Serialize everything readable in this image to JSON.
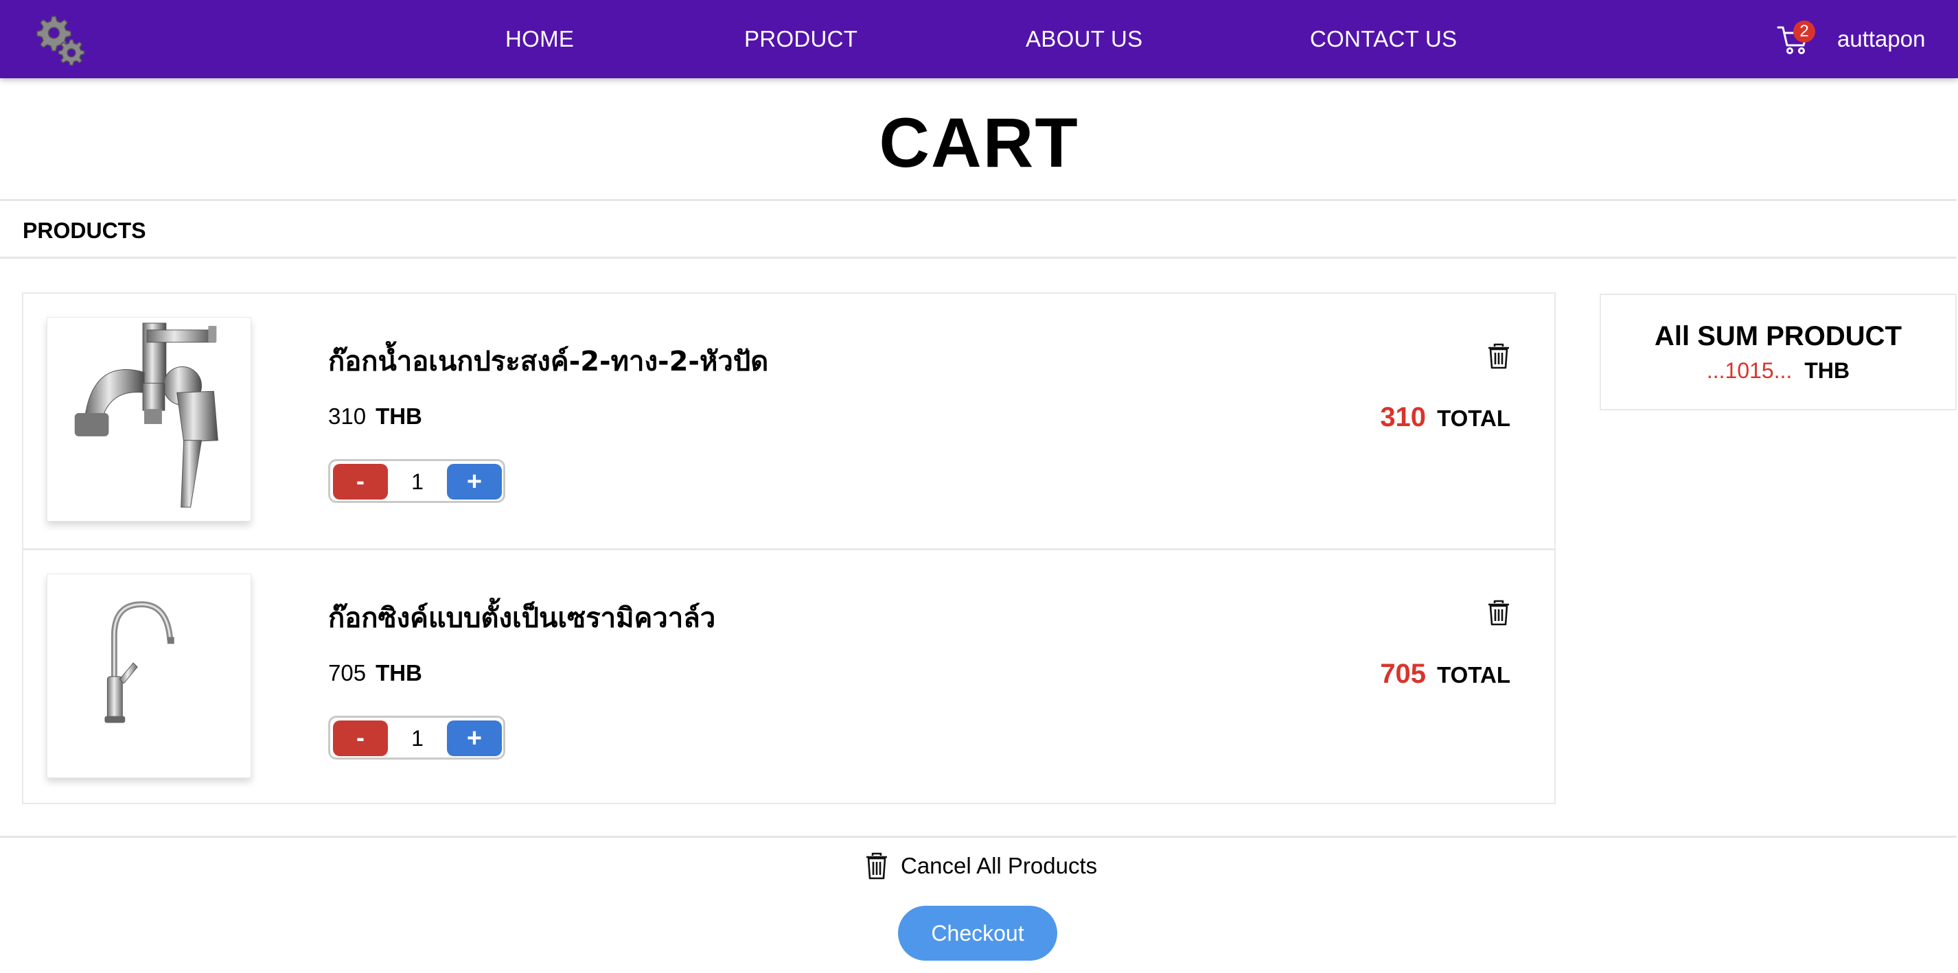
{
  "navbar": {
    "links": [
      "HOME",
      "PRODUCT",
      "ABOUT US",
      "CONTACT US"
    ],
    "cart_count": "2",
    "username": "auttapon",
    "logo_icon": "gears-icon",
    "cart_icon": "shopping-cart-icon"
  },
  "page": {
    "title": "CART",
    "section_label": "PRODUCTS"
  },
  "items": [
    {
      "name": "ก๊อกน้ำอเนกประสงค์-2-ทาง-2-หัวปัด",
      "price": "310",
      "currency": "THB",
      "quantity": "1",
      "total": "310",
      "total_label": "TOTAL",
      "minus_label": "-",
      "plus_label": "+"
    },
    {
      "name": "ก๊อกซิงค์แบบตั้งเป็นเซรามิควาล์ว",
      "price": "705",
      "currency": "THB",
      "quantity": "1",
      "total": "705",
      "total_label": "TOTAL",
      "minus_label": "-",
      "plus_label": "+"
    }
  ],
  "summary": {
    "title": "All SUM PRODUCT",
    "total": "...1015...",
    "currency": "THB"
  },
  "actions": {
    "cancel_all_label": "Cancel All Products",
    "checkout_label": "Checkout"
  },
  "colors": {
    "navbar": "#5213ab",
    "accent_red": "#d9342b",
    "minus_button": "#c73a32",
    "plus_button": "#3a79d5",
    "checkout_button": "#4f97ea"
  }
}
